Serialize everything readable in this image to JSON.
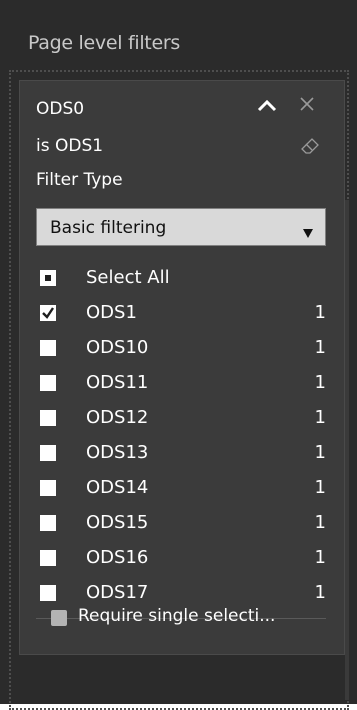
{
  "pane": {
    "title": "Page level filters"
  },
  "filter_card": {
    "field_name": "ODS0",
    "condition": "is ODS1",
    "filter_type_label": "Filter Type",
    "filter_type_value": "Basic filtering",
    "icons": {
      "collapse": "chevron-up-icon",
      "close": "close-icon",
      "clear": "eraser-icon",
      "dropdown": "triangle-down-icon"
    },
    "select_all": {
      "label": "Select All",
      "state": "partial"
    },
    "items": [
      {
        "label": "ODS1",
        "count": "1",
        "checked": true
      },
      {
        "label": "ODS10",
        "count": "1",
        "checked": false
      },
      {
        "label": "ODS11",
        "count": "1",
        "checked": false
      },
      {
        "label": "ODS12",
        "count": "1",
        "checked": false
      },
      {
        "label": "ODS13",
        "count": "1",
        "checked": false
      },
      {
        "label": "ODS14",
        "count": "1",
        "checked": false
      },
      {
        "label": "ODS15",
        "count": "1",
        "checked": false
      },
      {
        "label": "ODS16",
        "count": "1",
        "checked": false
      },
      {
        "label": "ODS17",
        "count": "1",
        "checked": false
      }
    ],
    "require_single_selection": {
      "label": "Require single selecti...",
      "checked": false
    }
  },
  "colors": {
    "pane_bg": "#2b2b2b",
    "card_bg": "#3b3b3b",
    "dropdown_bg": "#d9d9d9",
    "text": "#ffffff",
    "muted_text": "#c8c8c8"
  }
}
